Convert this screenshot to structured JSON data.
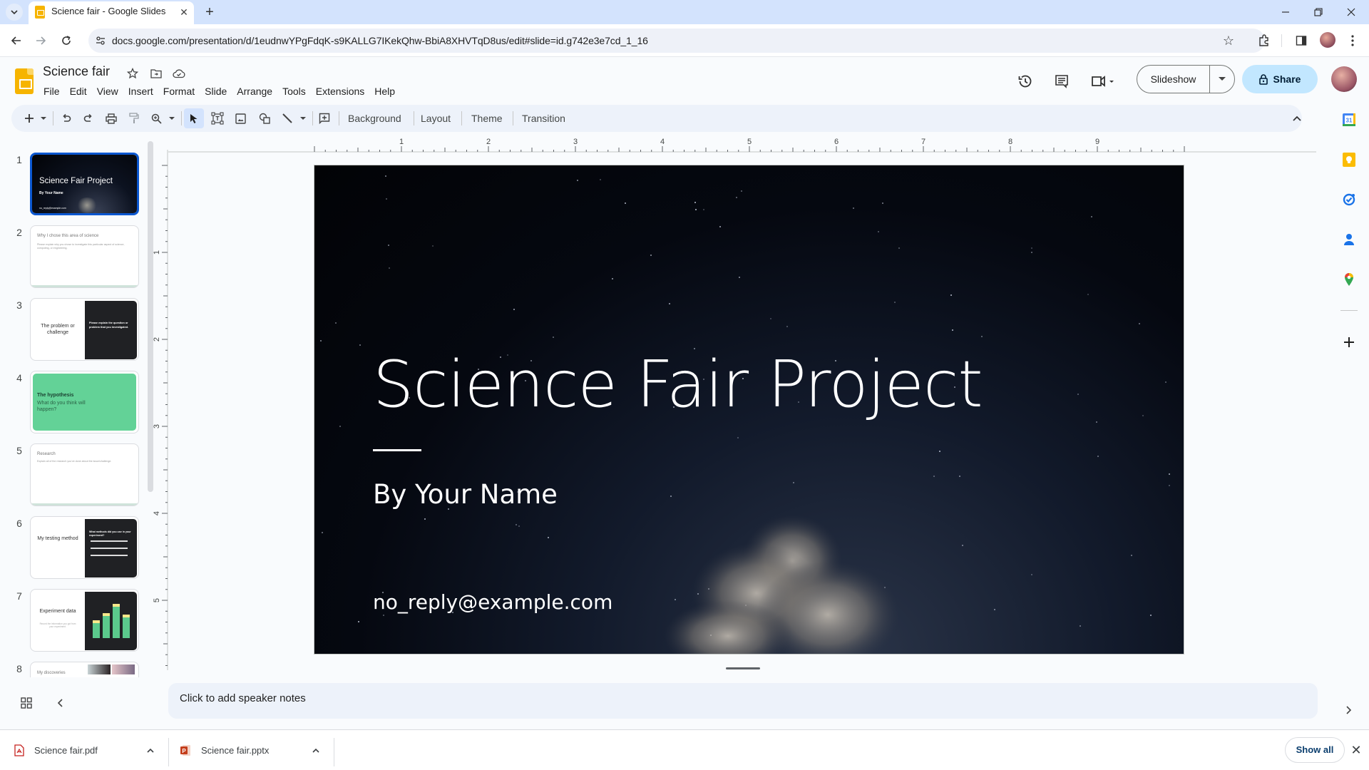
{
  "browser": {
    "tab_title": "Science fair - Google Slides",
    "url": "docs.google.com/presentation/d/1eudnwYPgFdqK-s9KALLG7IKekQhw-BbiA8XHVTqD8us/edit#slide=id.g742e3e7cd_1_16",
    "new_tab_label": "+",
    "tab_close_label": "✕"
  },
  "app": {
    "doc_title": "Science fair",
    "menu": [
      "File",
      "Edit",
      "View",
      "Insert",
      "Format",
      "Slide",
      "Arrange",
      "Tools",
      "Extensions",
      "Help"
    ],
    "slideshow_label": "Slideshow",
    "share_label": "Share",
    "brand_color": "#f6b400",
    "accent_color": "#0b57d0"
  },
  "toolbar": {
    "background_label": "Background",
    "layout_label": "Layout",
    "theme_label": "Theme",
    "transition_label": "Transition"
  },
  "ruler": {
    "horizontal_labels": [
      "1",
      "2",
      "3",
      "4",
      "5",
      "6",
      "7",
      "8",
      "9"
    ],
    "vertical_labels": [
      "1",
      "2",
      "3",
      "4",
      "5"
    ]
  },
  "filmstrip": {
    "slides": [
      {
        "num": "1",
        "title": "Science Fair Project",
        "subtitle": "By Your Name",
        "footer": "no_reply@example.com",
        "selected": true
      },
      {
        "num": "2",
        "title": "Why I chose this area of science",
        "body": "Please explain why you chose to investigate this particular aspect of science, computing, or engineering."
      },
      {
        "num": "3",
        "title": "The problem or challenge",
        "body": "Please explain the question or problem that you investigated."
      },
      {
        "num": "4",
        "title": "The hypothesis",
        "body": "What do you think will happen?"
      },
      {
        "num": "5",
        "title": "Research",
        "body": "Explain all of the research you've done about the issue/challenge."
      },
      {
        "num": "6",
        "title": "My testing method",
        "body": "What methods did you use in your experiment?"
      },
      {
        "num": "7",
        "title": "Experiment data",
        "body": "Record the information you got from your experiment."
      },
      {
        "num": "8",
        "title": "My discoveries"
      }
    ]
  },
  "slide": {
    "title": "Science Fair Project",
    "subtitle": "By Your Name",
    "email": "no_reply@example.com"
  },
  "notes": {
    "placeholder": "Click to add speaker notes"
  },
  "downloads": {
    "items": [
      {
        "name": "Science fair.pdf",
        "type": "pdf"
      },
      {
        "name": "Science fair.pptx",
        "type": "pptx"
      }
    ],
    "show_all_label": "Show all",
    "close_label": "✕"
  }
}
